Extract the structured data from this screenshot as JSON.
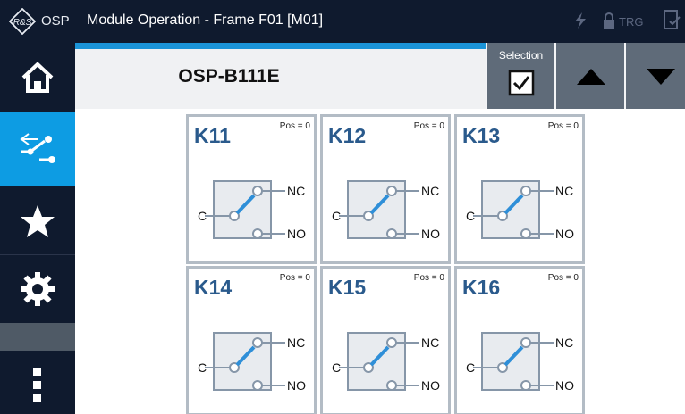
{
  "titlebar": {
    "brand": "OSP",
    "title": "Module Operation - Frame F01 [M01]",
    "trg": "TRG"
  },
  "sidebar": {
    "items": [
      {
        "name": "home",
        "icon": "home-icon"
      },
      {
        "name": "switch",
        "icon": "switch-icon",
        "active": true
      },
      {
        "name": "favorites",
        "icon": "star-icon"
      },
      {
        "name": "settings",
        "icon": "gear-icon"
      },
      {
        "name": "more",
        "icon": "more-vertical-icon"
      }
    ]
  },
  "header": {
    "device": "OSP-B111E",
    "selection_label": "Selection",
    "selection_checked": true
  },
  "cards": [
    {
      "name": "K11",
      "pos": "Pos = 0",
      "c": "C",
      "nc": "NC",
      "no": "NO"
    },
    {
      "name": "K12",
      "pos": "Pos = 0",
      "c": "C",
      "nc": "NC",
      "no": "NO"
    },
    {
      "name": "K13",
      "pos": "Pos = 0",
      "c": "C",
      "nc": "NC",
      "no": "NO"
    },
    {
      "name": "K14",
      "pos": "Pos = 0",
      "c": "C",
      "nc": "NC",
      "no": "NO"
    },
    {
      "name": "K15",
      "pos": "Pos = 0",
      "c": "C",
      "nc": "NC",
      "no": "NO"
    },
    {
      "name": "K16",
      "pos": "Pos = 0",
      "c": "C",
      "nc": "NC",
      "no": "NO"
    }
  ],
  "colors": {
    "sidebar": "#0f1a2e",
    "active": "#0d9ce3",
    "accent_line": "#1b94d8",
    "card_title": "#2a5a8c",
    "relay_blue": "#2f8fd8",
    "relay_gray": "#8696a8"
  }
}
